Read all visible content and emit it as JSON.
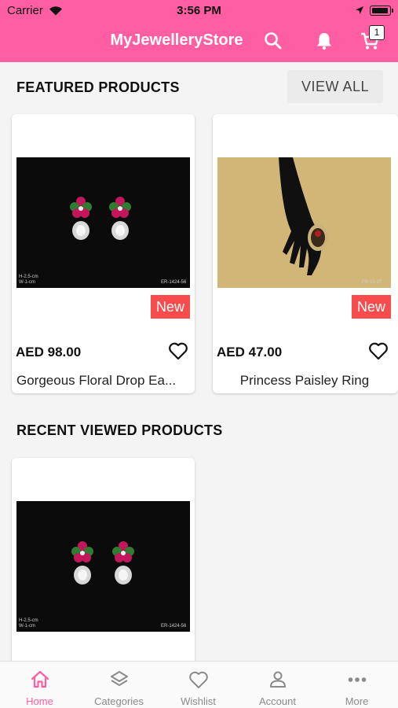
{
  "status_bar": {
    "carrier": "Carrier",
    "time": "3:56 PM"
  },
  "header": {
    "title": "MyJewelleryStore",
    "cart_count": "1",
    "icons": [
      "search-icon",
      "bell-icon",
      "cart-icon"
    ]
  },
  "featured": {
    "title": "FEATURED PRODUCTS",
    "view_all_label": "VIEW ALL",
    "products": [
      {
        "badge": "New",
        "price": "AED 98.00",
        "name": "Gorgeous Floral Drop Ea...",
        "img_left_caption_1": "H-2.5-cm",
        "img_left_caption_2": "W-1-cm",
        "img_right_caption": "ER-1424-56"
      },
      {
        "badge": "New",
        "price": "AED 47.00",
        "name": "Princess Paisley Ring",
        "img_right_caption": "FR-15-27"
      }
    ]
  },
  "recent": {
    "title": "RECENT VIEWED PRODUCTS",
    "products": [
      {
        "img_left_caption_1": "H-2.5-cm",
        "img_left_caption_2": "W-1-cm",
        "img_right_caption": "ER-1424-56"
      }
    ]
  },
  "tabs": [
    {
      "label": "Home",
      "icon": "home-icon",
      "active": true
    },
    {
      "label": "Categories",
      "icon": "layers-icon",
      "active": false
    },
    {
      "label": "Wishlist",
      "icon": "heart-icon",
      "active": false
    },
    {
      "label": "Account",
      "icon": "person-icon",
      "active": false
    },
    {
      "label": "More",
      "icon": "more-icon",
      "active": false
    }
  ],
  "colors": {
    "accent": "#ff5fa2",
    "badge": "#f84b4b",
    "tab_inactive": "#8a8a8a"
  }
}
